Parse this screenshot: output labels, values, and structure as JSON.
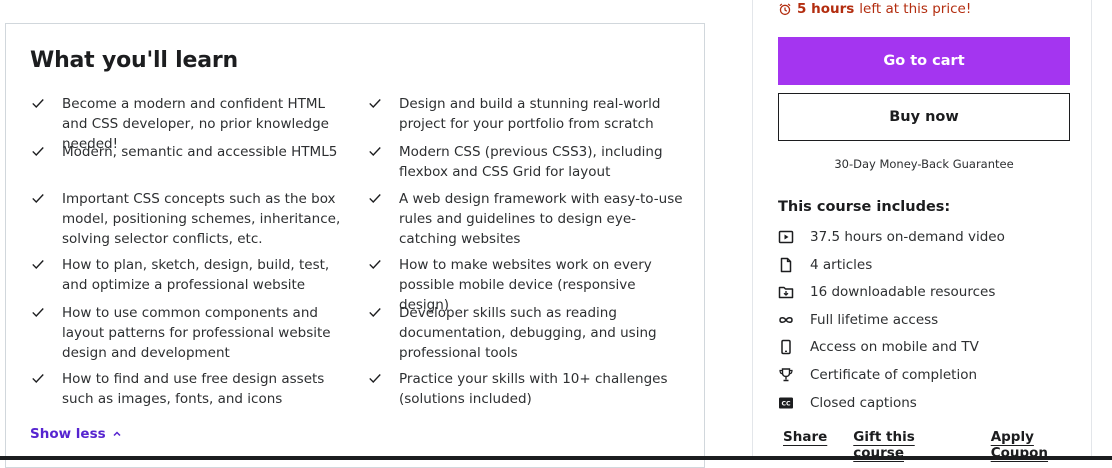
{
  "learn": {
    "title": "What you'll learn",
    "left_items": [
      "Become a modern and confident HTML and CSS developer, no prior knowledge needed!",
      "Modern, semantic and accessible HTML5",
      "Important CSS concepts such as the box model, positioning schemes, inheritance, solving selector conflicts, etc.",
      "How to plan, sketch, design, build, test, and optimize a professional website",
      "How to use common components and layout patterns for professional website design and development",
      "How to find and use free design assets such as images, fonts, and icons"
    ],
    "right_items": [
      "Design and build a stunning real-world project for your portfolio from scratch",
      "Modern CSS (previous CSS3), including flexbox and CSS Grid for layout",
      "A web design framework with easy-to-use rules and guidelines to design eye-catching websites",
      "How to make websites work on every possible mobile device (responsive design)",
      "Developer skills such as reading documentation, debugging, and using professional tools",
      "Practice your skills with 10+ challenges (solutions included)"
    ],
    "show_less": "Show less"
  },
  "sidebar": {
    "timer_bold": "5 hours",
    "timer_rest": "left at this price!",
    "cart_label": "Go to cart",
    "buy_label": "Buy now",
    "guarantee": "30-Day Money-Back Guarantee",
    "includes_title": "This course includes:",
    "includes": [
      {
        "icon": "video-icon",
        "label": "37.5 hours on-demand video"
      },
      {
        "icon": "file-icon",
        "label": "4 articles"
      },
      {
        "icon": "download-folder-icon",
        "label": "16 downloadable resources"
      },
      {
        "icon": "infinity-icon",
        "label": "Full lifetime access"
      },
      {
        "icon": "mobile-icon",
        "label": "Access on mobile and TV"
      },
      {
        "icon": "trophy-icon",
        "label": "Certificate of completion"
      },
      {
        "icon": "closed-captions-icon",
        "label": "Closed captions"
      }
    ],
    "links": [
      "Share",
      "Gift this course",
      "Apply Coupon"
    ]
  },
  "colors": {
    "accent_purple": "#a435f0",
    "link_purple": "#5624d0",
    "timer_red": "#b32d0f"
  }
}
